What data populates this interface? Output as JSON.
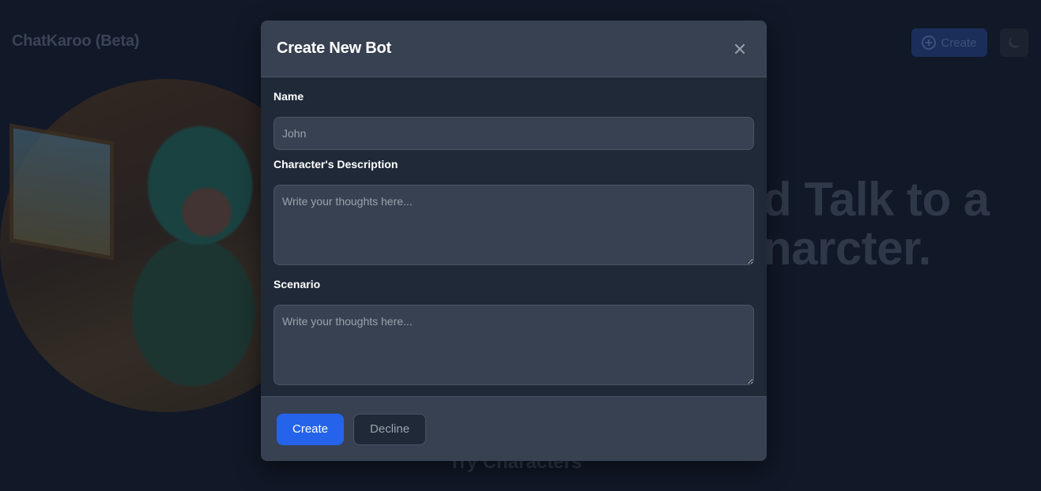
{
  "background": {
    "brand": "ChatKaroo (Beta)",
    "create_label": "Create",
    "hero_line1": "d Talk to a",
    "hero_line2": "narcter.",
    "try_heading": "Try Characters"
  },
  "modal": {
    "title": "Create New Bot",
    "fields": {
      "name": {
        "label": "Name",
        "placeholder": "John",
        "value": ""
      },
      "description": {
        "label": "Character's Description",
        "placeholder": "Write your thoughts here...",
        "value": ""
      },
      "scenario": {
        "label": "Scenario",
        "placeholder": "Write your thoughts here...",
        "value": ""
      }
    },
    "buttons": {
      "create": "Create",
      "decline": "Decline"
    }
  },
  "colors": {
    "page_bg": "#111827",
    "modal_body": "#1f2937",
    "modal_header": "#374151",
    "primary": "#2563eb"
  },
  "icons": {
    "close": "close-icon",
    "bg_create": "plus-circle-icon",
    "theme": "moon-icon"
  }
}
